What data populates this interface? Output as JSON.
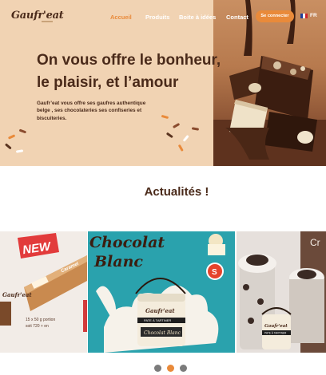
{
  "brand": {
    "logo": "Gaufr'eat"
  },
  "nav": {
    "links": [
      "Accueil",
      "Produits",
      "Boite à idées",
      "Contact"
    ],
    "login": "Se connecter",
    "lang": "FR"
  },
  "hero": {
    "title_line1": "On vous offre le bonheur,",
    "title_line2": "le plaisir, et l’amour",
    "text": "Gaufr’eat vous offre ses gaufres authentique belge , ses chocolateries ses confiseries et biscuiteries."
  },
  "news": {
    "title": "Actualités !",
    "slides": {
      "left": {
        "badge": "NEW",
        "pack_label": "Caramel",
        "pack_brand": "Gaufr'eat",
        "info_line1": "15 x 50 g portion",
        "info_line2": "soit 720 + en"
      },
      "center": {
        "heading_line1": "Chocolat",
        "heading_line2": "Blanc",
        "badge": "S",
        "jar_brand": "Gaufr'eat",
        "jar_band": "PATE À TARTINER",
        "jar_label": "Chocolat Blanc"
      },
      "right": {
        "heading": "Cr",
        "jar_brand": "Gaufr'eat",
        "jar_band": "PATE À TARTINER"
      }
    },
    "carousel": {
      "count": 3,
      "active": 2
    }
  },
  "colors": {
    "accent": "#e98a3a",
    "brown": "#4a2a1a",
    "hero_bg": "#f1d3b3",
    "teal": "#2aa2ad"
  }
}
